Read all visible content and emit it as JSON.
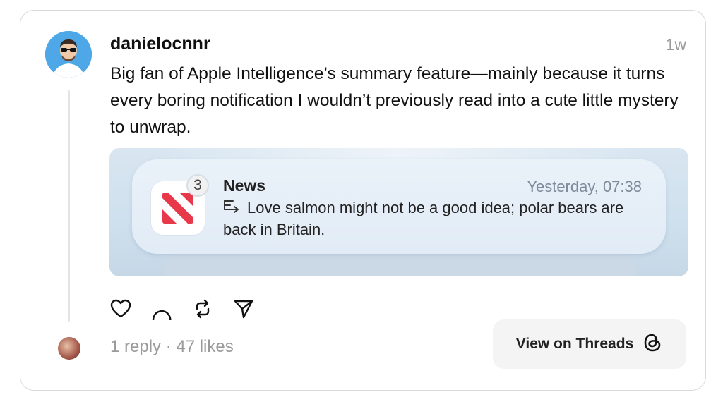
{
  "post": {
    "username": "danielocnnr",
    "timestamp": "1w",
    "text": "Big fan of Apple Intelligence’s summary feature—mainly because it turns every boring notification I wouldn’t previously read into a cute little mystery to unwrap."
  },
  "notification": {
    "app_name": "News",
    "badge_count": "3",
    "time": "Yesterday, 07:38",
    "summary": "Love salmon might not be a good idea; polar bears are back in Britain.",
    "icon": "apple-news-icon"
  },
  "actions": {
    "icons": [
      "heart-icon",
      "comment-icon",
      "repost-icon",
      "share-icon"
    ]
  },
  "footer": {
    "stats": "1 reply · 47 likes",
    "view_button_label": "View on Threads",
    "threads_icon": "threads-logo-icon"
  },
  "colors": {
    "avatar_bg": "#4ea8e8",
    "news_red": "#e8394a",
    "muted_text": "#9a9a9a"
  }
}
